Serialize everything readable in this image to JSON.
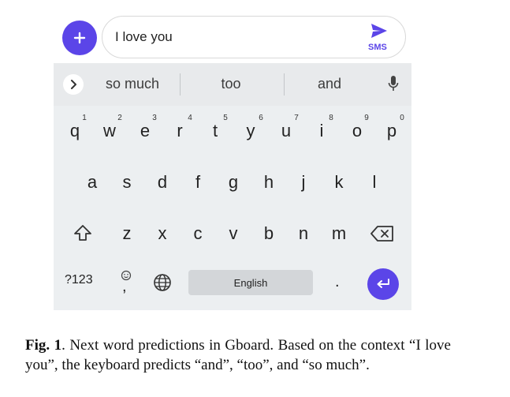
{
  "compose": {
    "message": "I love you",
    "send_label": "SMS"
  },
  "suggestions": [
    "so much",
    "too",
    "and"
  ],
  "keys": {
    "row1": [
      {
        "key": "q",
        "hint": "1"
      },
      {
        "key": "w",
        "hint": "2"
      },
      {
        "key": "e",
        "hint": "3"
      },
      {
        "key": "r",
        "hint": "4"
      },
      {
        "key": "t",
        "hint": "5"
      },
      {
        "key": "y",
        "hint": "6"
      },
      {
        "key": "u",
        "hint": "7"
      },
      {
        "key": "i",
        "hint": "8"
      },
      {
        "key": "o",
        "hint": "9"
      },
      {
        "key": "p",
        "hint": "0"
      }
    ],
    "row2": [
      "a",
      "s",
      "d",
      "f",
      "g",
      "h",
      "j",
      "k",
      "l"
    ],
    "row3": [
      "z",
      "x",
      "c",
      "v",
      "b",
      "n",
      "m"
    ],
    "bottom": {
      "symbols": "?123",
      "comma": ",",
      "space": "English",
      "period": "."
    }
  },
  "caption": {
    "label": "Fig. 1",
    "text": ". Next word predictions in Gboard. Based on the context “I love you”, the keyboard predicts “and”, “too”, and “so much”."
  },
  "colors": {
    "accent": "#5b45e8",
    "keyboard_bg": "#eceff1"
  },
  "icons": [
    "plus-icon",
    "send-icon",
    "chevron-right-icon",
    "mic-icon",
    "shift-icon",
    "backspace-icon",
    "emoji-icon",
    "globe-icon",
    "enter-icon"
  ]
}
